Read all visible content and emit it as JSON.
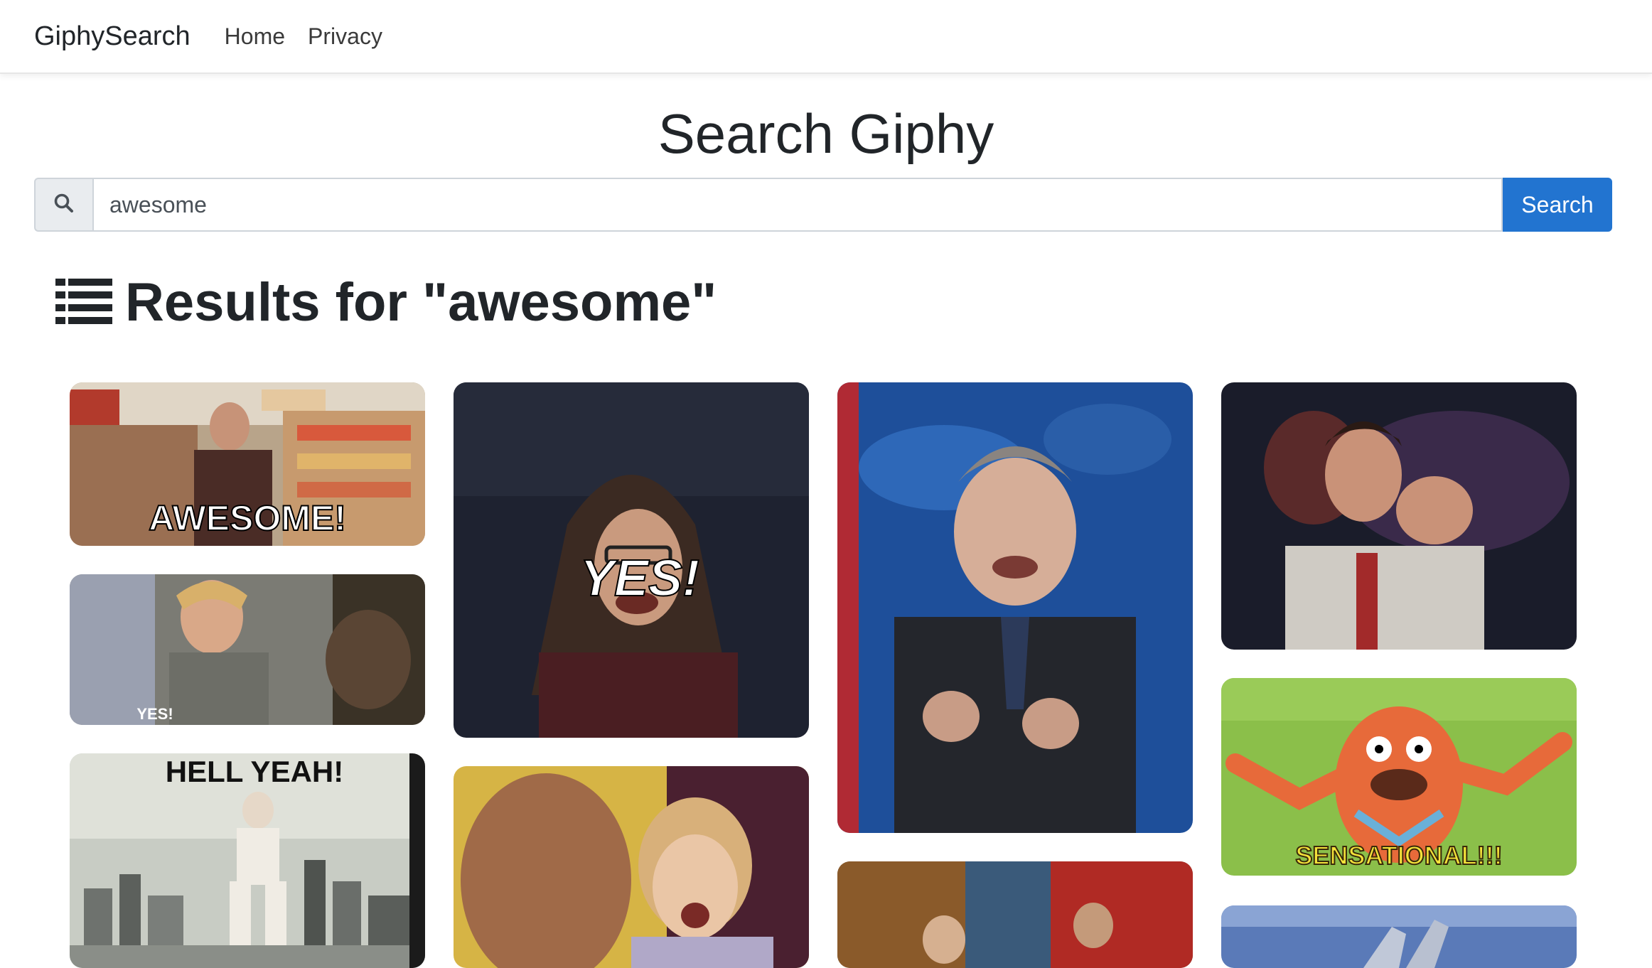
{
  "navbar": {
    "brand": "GiphySearch",
    "links": [
      "Home",
      "Privacy"
    ]
  },
  "page_title": "Search Giphy",
  "search": {
    "icon": "search-icon",
    "value": "awesome",
    "button_label": "Search"
  },
  "results": {
    "icon": "list-icon",
    "heading": "Results for \"awesome\""
  },
  "gifs": [
    {
      "caption": "AWESOME!"
    },
    {
      "caption": "YES!"
    },
    {
      "caption": "HELL YEAH!"
    },
    {
      "caption": "YES!"
    },
    {
      "caption": ""
    },
    {
      "caption": ""
    },
    {
      "caption": ""
    },
    {
      "caption": ""
    },
    {
      "caption": "SENSATIONAL!!!"
    },
    {
      "caption": ""
    }
  ],
  "colors": {
    "primary": "#2274d0",
    "text": "#212529",
    "addon_bg": "#e9ecef"
  }
}
